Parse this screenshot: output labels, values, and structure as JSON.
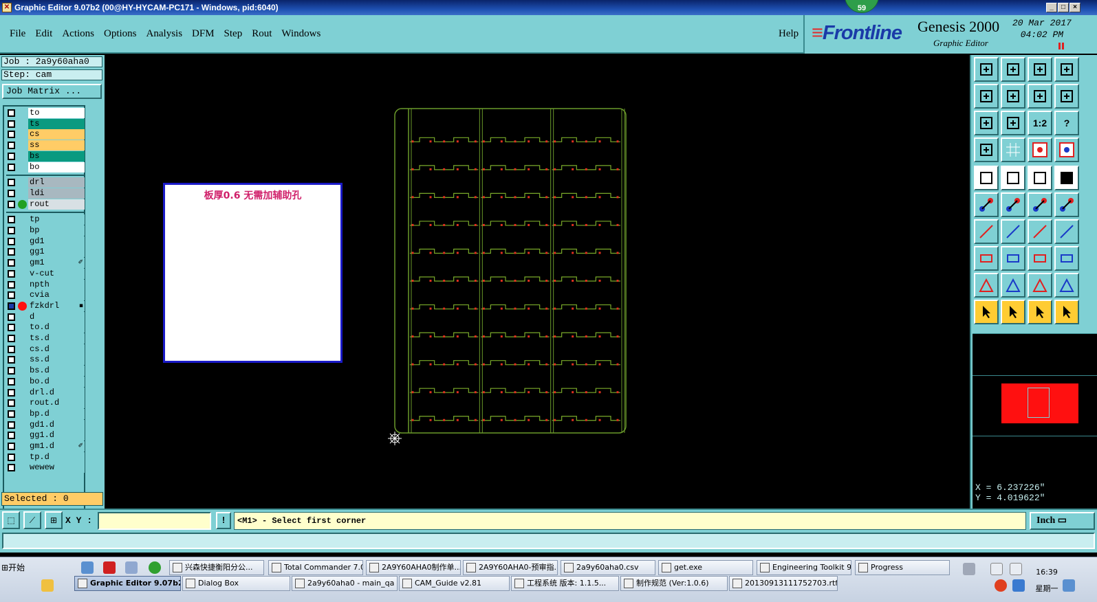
{
  "window": {
    "title": "Graphic Editor 9.07b2 (00@HY-HYCAM-PC171 - Windows, pid:6040)",
    "notification_count": "59",
    "controls": [
      "_",
      "□",
      "×"
    ]
  },
  "menu": {
    "items": [
      "File",
      "Edit",
      "Actions",
      "Options",
      "Analysis",
      "DFM",
      "Step",
      "Rout",
      "Windows"
    ],
    "help": "Help"
  },
  "brand": {
    "logo": "Frontline",
    "title": "Genesis 2000",
    "subtitle": "Graphic Editor",
    "date": "20 Mar 2017",
    "time": "04:02 PM"
  },
  "job": {
    "job_label": "Job : 2a9y60aha0",
    "step_label": "Step: cam",
    "matrix_button": "Job Matrix ..."
  },
  "layers": {
    "group1": [
      {
        "name": "to",
        "color": "#ffffff"
      },
      {
        "name": "ts",
        "color": "#0a9a80"
      },
      {
        "name": "cs",
        "color": "#ffcc66"
      },
      {
        "name": "ss",
        "color": "#ffcc66"
      },
      {
        "name": "bs",
        "color": "#0a9a80"
      },
      {
        "name": "bo",
        "color": "#ffffff"
      }
    ],
    "group2": [
      {
        "name": "drl",
        "color": "#a8b8c0"
      },
      {
        "name": "ldi",
        "color": "#a8b8c0"
      },
      {
        "name": "rout",
        "color": "#d8e0e4",
        "dot": "#22a022"
      }
    ],
    "group3": [
      {
        "name": "tp"
      },
      {
        "name": "bp"
      },
      {
        "name": "gd1"
      },
      {
        "name": "gg1"
      },
      {
        "name": "gm1",
        "mark": "✐"
      },
      {
        "name": "v-cut"
      },
      {
        "name": "npth"
      },
      {
        "name": "cvia"
      },
      {
        "name": "fzkdrl",
        "dot": "#ff1010",
        "mark": "▪",
        "highlight": true
      },
      {
        "name": "d"
      },
      {
        "name": "to.d"
      },
      {
        "name": "ts.d"
      },
      {
        "name": "cs.d"
      },
      {
        "name": "ss.d"
      },
      {
        "name": "bs.d"
      },
      {
        "name": "bo.d"
      },
      {
        "name": "drl.d"
      },
      {
        "name": "rout.d"
      },
      {
        "name": "bp.d"
      },
      {
        "name": "gd1.d"
      },
      {
        "name": "gg1.d"
      },
      {
        "name": "gm1.d",
        "mark": "✐"
      },
      {
        "name": "tp.d"
      },
      {
        "name": "wewew"
      }
    ],
    "selected_label": "Selected : 0"
  },
  "canvas": {
    "note_text": "板厚0.6  无需加辅助孔",
    "board": {
      "rows": 11,
      "cols": 3
    }
  },
  "toolbar": {
    "icons": [
      "export-icon",
      "import-icon",
      "home-icon",
      "view-icon",
      "step-left-icon",
      "step-right-icon",
      "swap-icon",
      "flip-icon",
      "fit-icon",
      "zoom-fit-icon",
      "scale-icon",
      "help-icon",
      "config-icon",
      "grid-icon",
      "snap-red-icon",
      "snap-blue-icon",
      "pad-icon",
      "edit-shape-icon",
      "ruler-icon",
      "circle-icon",
      "connect-icon",
      "cross-icon",
      "arrow-red-icon",
      "arrow-blue-icon",
      "line-red-icon",
      "line-blue-icon",
      "undo-arc-icon",
      "mirror-icon",
      "pin-icon",
      "line-cut-icon",
      "measure-icon",
      "group-icon",
      "triangle-red-icon",
      "triangle-a-icon",
      "triangle-blue-icon",
      "triangle-cut-icon",
      "select-icon",
      "select-red-icon",
      "select-frame-icon",
      "select-net-icon"
    ],
    "labels": {
      "scale-icon": "1:2",
      "help-icon": "?"
    }
  },
  "coords": {
    "x": "X = 6.237226\"",
    "y": "Y = 4.019622\""
  },
  "command": {
    "xy_label": "X Y :",
    "xy_value": "",
    "warn": "!",
    "prompt": "<M1> - Select first corner",
    "unit": "Inch"
  },
  "taskbar": {
    "start": "开始",
    "row1": [
      "兴森快捷衡阳分公...",
      "Total Commander 7.0...",
      "2A9Y60AHA0制作单...",
      "2A9Y60AHA0-预审指...",
      "2a9y60aha0.csv",
      "get.exe",
      "Engineering Toolkit 9....",
      "Progress"
    ],
    "row2": [
      "Graphic Editor 9.07b2 ...",
      "Dialog Box",
      "2a9y60aha0 - main_qa",
      "CAM_Guide v2.81",
      "工程系统  版本: 1.1.5...",
      "制作规范 (Ver:1.0.6)",
      "20130913111752703.rtf..."
    ],
    "time": "16:39",
    "day": "星期一"
  }
}
